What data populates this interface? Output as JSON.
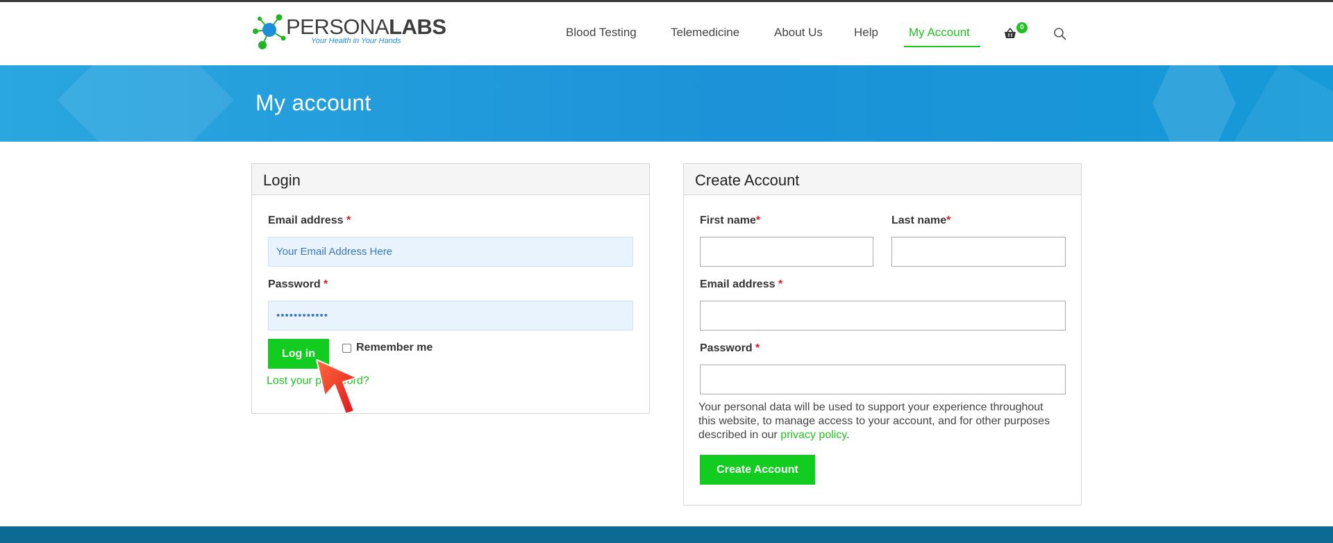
{
  "header": {
    "logo": {
      "name_light": "PERSONA",
      "name_bold": "LABS",
      "tagline": "Your Health in Your Hands"
    },
    "nav": [
      {
        "label": "Blood Testing"
      },
      {
        "label": "Telemedicine"
      },
      {
        "label": "About Us"
      },
      {
        "label": "Help"
      },
      {
        "label": "My Account",
        "active": true
      }
    ],
    "cart": {
      "icon": "basket-icon",
      "count": "0"
    },
    "search": {
      "icon": "search-icon"
    }
  },
  "banner": {
    "title": "My account"
  },
  "login": {
    "title": "Login",
    "email_label": "Email address",
    "email_placeholder": "Your Email Address Here",
    "password_label": "Password",
    "password_value": "••••••••••••",
    "required_mark": "*",
    "login_button": "Log in",
    "remember_label": "Remember me",
    "lost_password": "Lost your password?"
  },
  "register": {
    "title": "Create Account",
    "first_name_label": "First name",
    "last_name_label": "Last name",
    "email_label": "Email address",
    "password_label": "Password",
    "required_mark": "*",
    "privacy_text_before": "Your personal data will be used to support your experience throughout this website, to manage access to your account, and for other purposes described in our ",
    "privacy_link": "privacy policy",
    "privacy_text_after": ".",
    "create_button": "Create Account"
  },
  "colors": {
    "accent_green": "#12cc1f",
    "banner_blue": "#1c92d8",
    "footer_blue": "#0d6a93",
    "required_red": "#e8161f"
  }
}
